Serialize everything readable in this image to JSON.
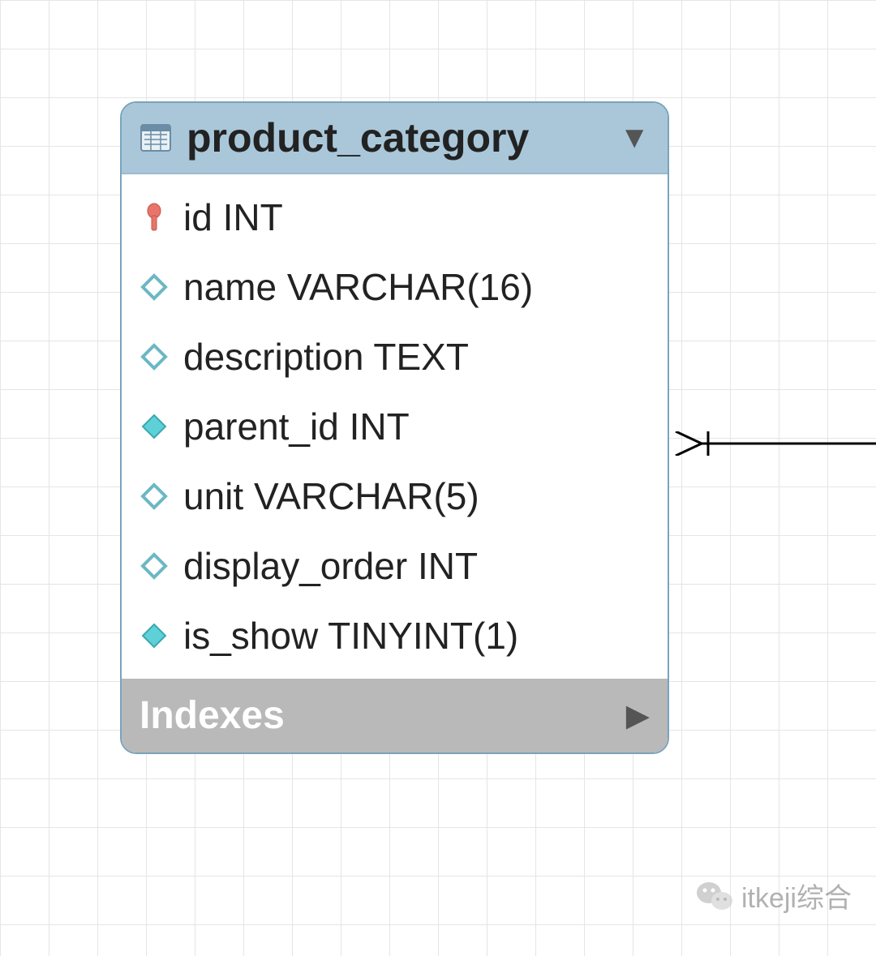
{
  "table": {
    "name": "product_category",
    "columns": [
      {
        "label": "id INT",
        "icon": "key"
      },
      {
        "label": "name VARCHAR(16)",
        "icon": "diamond-open"
      },
      {
        "label": "description TEXT",
        "icon": "diamond-open"
      },
      {
        "label": "parent_id INT",
        "icon": "diamond-filled"
      },
      {
        "label": "unit VARCHAR(5)",
        "icon": "diamond-open"
      },
      {
        "label": "display_order INT",
        "icon": "diamond-open"
      },
      {
        "label": "is_show TINYINT(1)",
        "icon": "diamond-filled"
      }
    ],
    "footer_label": "Indexes"
  },
  "watermark": "itkeji综合"
}
